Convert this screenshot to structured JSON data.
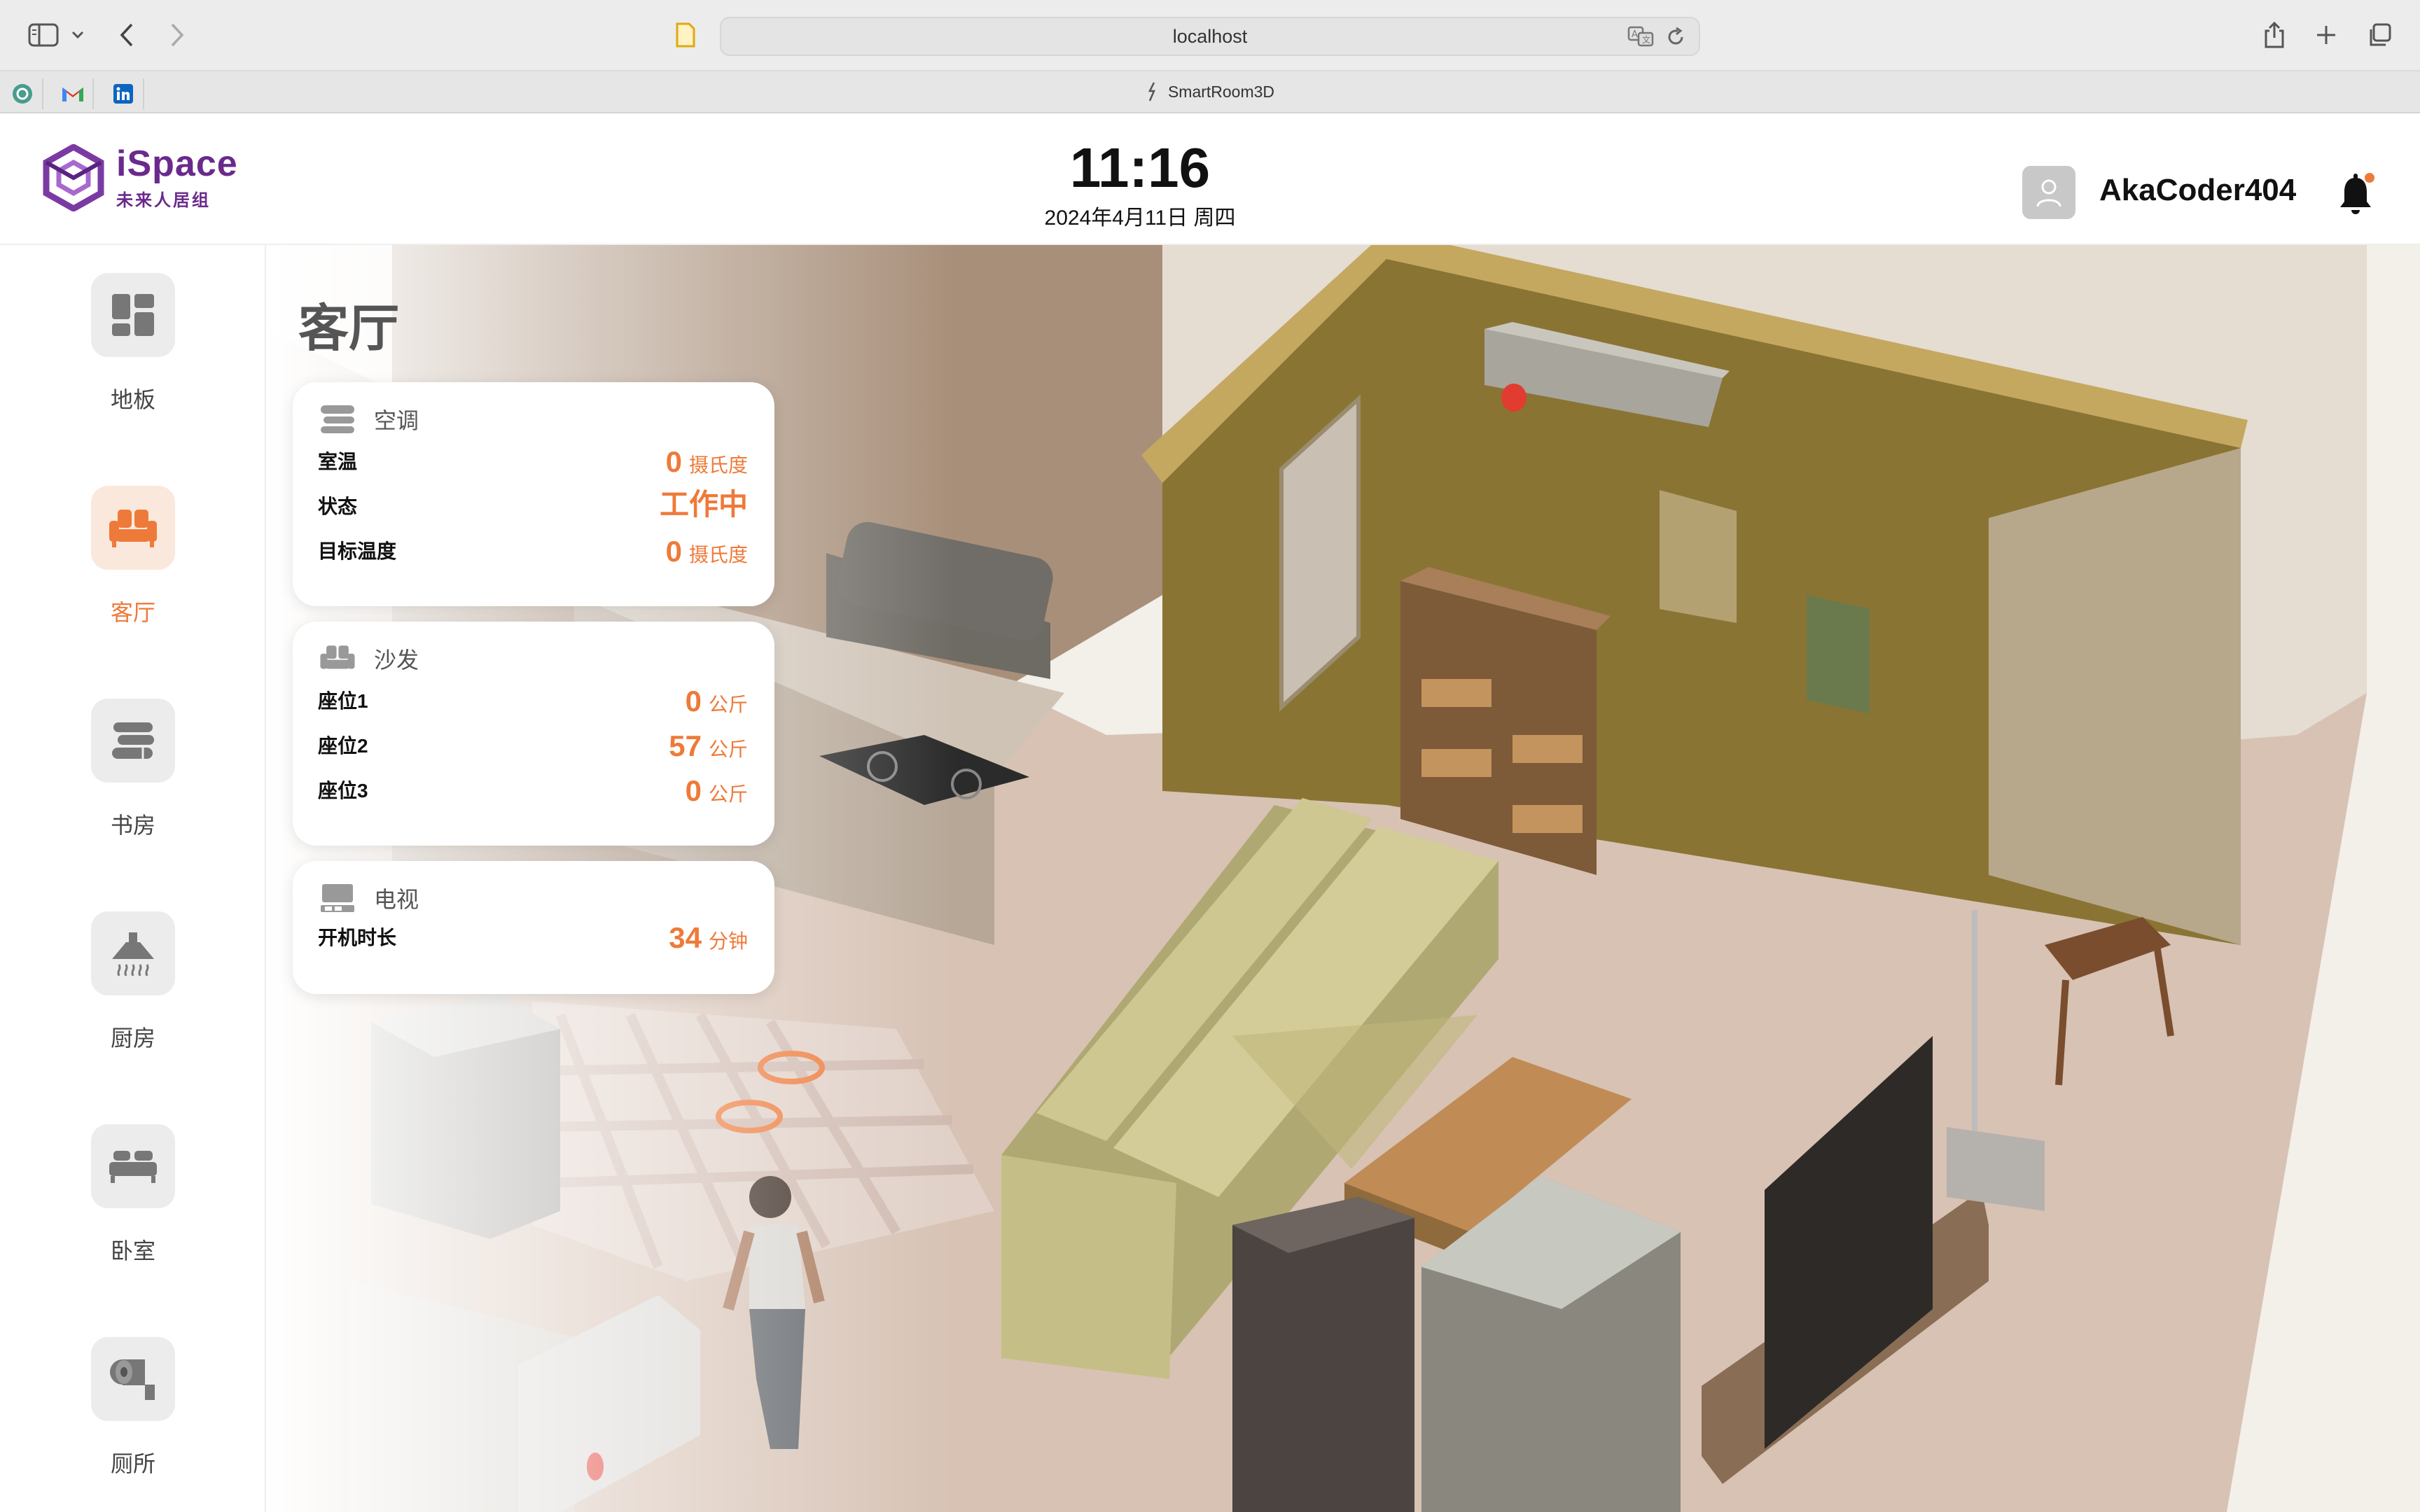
{
  "browser": {
    "url": "localhost",
    "tab_title": "SmartRoom3D"
  },
  "header": {
    "logo_main": "iSpace",
    "logo_sub": "未来人居组",
    "time": "11:16",
    "date": "2024年4月11日 周四",
    "username": "AkaCoder404"
  },
  "sidebar": {
    "items": [
      {
        "label": "地板",
        "icon": "floorplan-icon"
      },
      {
        "label": "客厅",
        "icon": "sofa-icon",
        "active": true
      },
      {
        "label": "书房",
        "icon": "books-icon"
      },
      {
        "label": "厨房",
        "icon": "range-hood-icon"
      },
      {
        "label": "卧室",
        "icon": "bed-icon"
      },
      {
        "label": "厕所",
        "icon": "toilet-paper-icon"
      }
    ]
  },
  "room": {
    "title": "客厅"
  },
  "cards": {
    "ac": {
      "title": "空调",
      "rows": [
        {
          "label": "室温",
          "value": "0",
          "unit": "摄氏度"
        },
        {
          "label": "状态",
          "value": "工作中",
          "unit": ""
        },
        {
          "label": "目标温度",
          "value": "0",
          "unit": "摄氏度"
        }
      ]
    },
    "sofa": {
      "title": "沙发",
      "rows": [
        {
          "label": "座位1",
          "value": "0",
          "unit": "公斤"
        },
        {
          "label": "座位2",
          "value": "57",
          "unit": "公斤"
        },
        {
          "label": "座位3",
          "value": "0",
          "unit": "公斤"
        }
      ]
    },
    "tv": {
      "title": "电视",
      "rows": [
        {
          "label": "开机时长",
          "value": "34",
          "unit": "分钟"
        }
      ]
    }
  },
  "colors": {
    "accent": "#ee7a3a",
    "brand": "#6a2a8c",
    "wall": "#8a7434",
    "floor": "#d7c2b4"
  }
}
